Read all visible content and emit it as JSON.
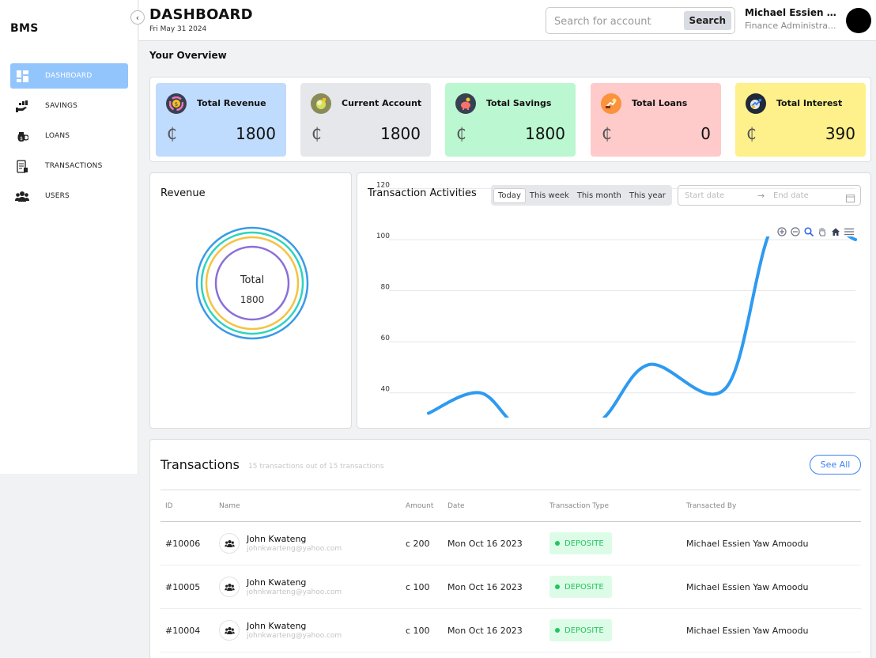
{
  "app": {
    "brand": "BMS"
  },
  "sidebar": {
    "items": [
      {
        "label": "DASHBOARD",
        "icon": "dashboard-icon",
        "active": true
      },
      {
        "label": "SAVINGS",
        "icon": "savings-icon"
      },
      {
        "label": "LOANS",
        "icon": "loans-icon"
      },
      {
        "label": "TRANSACTIONS",
        "icon": "transactions-icon"
      },
      {
        "label": "USERS",
        "icon": "users-icon"
      }
    ]
  },
  "header": {
    "title": "DASHBOARD",
    "date": "Fri May 31 2024",
    "search_placeholder": "Search for account",
    "search_button": "Search",
    "user_name": "Michael Essien ...",
    "user_role": "Finance Administra..."
  },
  "overview": {
    "title": "Your Overview",
    "currency_symbol": "₵",
    "cards": [
      {
        "label": "Total Revenue",
        "value": "1800",
        "bg": "#bfdbfe",
        "icon": "revenue-icon"
      },
      {
        "label": "Current Account",
        "value": "1800",
        "bg": "#e5e7eb",
        "icon": "current-account-icon"
      },
      {
        "label": "Total Savings",
        "value": "1800",
        "bg": "#bbf7d0",
        "icon": "savings-pig-icon"
      },
      {
        "label": "Total Loans",
        "value": "0",
        "bg": "#fecaca",
        "icon": "loan-icon"
      },
      {
        "label": "Total Interest",
        "value": "390",
        "bg": "#fef08a",
        "icon": "interest-icon"
      }
    ]
  },
  "revenue": {
    "title": "Revenue",
    "center_label": "Total",
    "center_value": "1800",
    "ring_colors": [
      "#3b9ae8",
      "#2dd4bf",
      "#f5c242",
      "#8b6fd8"
    ]
  },
  "activities": {
    "title": "Transaction Activities",
    "periods": [
      "Today",
      "This week",
      "This month",
      "This year"
    ],
    "active_period": "Today",
    "start_placeholder": "Start date",
    "end_placeholder": "End date"
  },
  "chart_data": {
    "type": "line",
    "title": "",
    "series": [
      {
        "points": [
          [
            0,
            32
          ],
          [
            0.8,
            40
          ],
          [
            1.5,
            25
          ],
          [
            2.6,
            28
          ],
          [
            3.4,
            51
          ],
          [
            4.6,
            42
          ],
          [
            5.4,
            109
          ],
          [
            6.6,
            100
          ]
        ]
      }
    ],
    "y_ticks": [
      40,
      60,
      80,
      100,
      120
    ],
    "ylim": [
      30,
      126
    ],
    "xlim": [
      0,
      6.6
    ],
    "grid": true,
    "color": "#2e9af0"
  },
  "transactions": {
    "title": "Transactions",
    "subtitle": "15 transactions out of 15 transactions",
    "see_all": "See All",
    "columns": [
      "ID",
      "Name",
      "Amount",
      "Date",
      "Transaction Type",
      "Transacted By"
    ],
    "rows": [
      {
        "id": "#10006",
        "name": "John Kwateng",
        "email": "johnkwarteng@yahoo.com",
        "amount": "c 200",
        "date": "Mon Oct 16 2023",
        "type": "DEPOSITE",
        "by": "Michael Essien Yaw Amoodu"
      },
      {
        "id": "#10005",
        "name": "John Kwateng",
        "email": "johnkwarteng@yahoo.com",
        "amount": "c 100",
        "date": "Mon Oct 16 2023",
        "type": "DEPOSITE",
        "by": "Michael Essien Yaw Amoodu"
      },
      {
        "id": "#10004",
        "name": "John Kwateng",
        "email": "johnkwarteng@yahoo.com",
        "amount": "c 100",
        "date": "Mon Oct 16 2023",
        "type": "DEPOSITE",
        "by": "Michael Essien Yaw Amoodu"
      }
    ]
  }
}
